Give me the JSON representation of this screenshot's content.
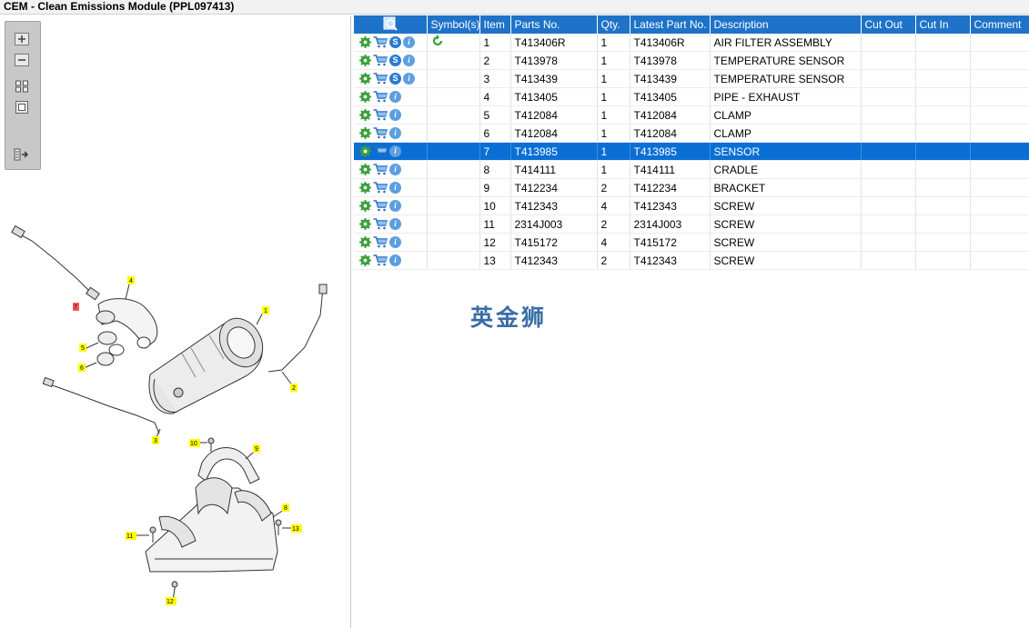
{
  "window": {
    "title": "CEM - Clean Emissions Module (PPL097413)"
  },
  "toolbar": {
    "buttons": [
      {
        "icon": "zoom-in-icon"
      },
      {
        "icon": "zoom-out-icon"
      },
      {
        "icon": "fit-all-icon"
      },
      {
        "icon": "fit-window-icon"
      },
      {
        "icon": "toggle-pane-icon"
      }
    ]
  },
  "diagram": {
    "callouts": [
      "1",
      "2",
      "3",
      "4",
      "5",
      "6",
      "7",
      "8",
      "9",
      "10",
      "11",
      "12",
      "13"
    ]
  },
  "table": {
    "columns": [
      "",
      "Symbol(s)",
      "Item",
      "Parts No.",
      "Qty.",
      "Latest Part No.",
      "Description",
      "Cut Out",
      "Cut In",
      "Comment"
    ],
    "rows": [
      {
        "item": "1",
        "part": "T413406R",
        "qty": "1",
        "latest": "T413406R",
        "desc": "AIR FILTER ASSEMBLY",
        "s": true,
        "symbol": "refresh-arrow"
      },
      {
        "item": "2",
        "part": "T413978",
        "qty": "1",
        "latest": "T413978",
        "desc": "TEMPERATURE SENSOR",
        "s": true
      },
      {
        "item": "3",
        "part": "T413439",
        "qty": "1",
        "latest": "T413439",
        "desc": "TEMPERATURE SENSOR",
        "s": true
      },
      {
        "item": "4",
        "part": "T413405",
        "qty": "1",
        "latest": "T413405",
        "desc": "PIPE - EXHAUST",
        "s": false
      },
      {
        "item": "5",
        "part": "T412084",
        "qty": "1",
        "latest": "T412084",
        "desc": "CLAMP",
        "s": false
      },
      {
        "item": "6",
        "part": "T412084",
        "qty": "1",
        "latest": "T412084",
        "desc": "CLAMP",
        "s": false
      },
      {
        "item": "7",
        "part": "T413985",
        "qty": "1",
        "latest": "T413985",
        "desc": "SENSOR",
        "s": false,
        "selected": true
      },
      {
        "item": "8",
        "part": "T414111",
        "qty": "1",
        "latest": "T414111",
        "desc": "CRADLE",
        "s": false
      },
      {
        "item": "9",
        "part": "T412234",
        "qty": "2",
        "latest": "T412234",
        "desc": "BRACKET",
        "s": false
      },
      {
        "item": "10",
        "part": "T412343",
        "qty": "4",
        "latest": "T412343",
        "desc": "SCREW",
        "s": false
      },
      {
        "item": "11",
        "part": "2314J003",
        "qty": "2",
        "latest": "2314J003",
        "desc": "SCREW",
        "s": false
      },
      {
        "item": "12",
        "part": "T415172",
        "qty": "4",
        "latest": "T415172",
        "desc": "SCREW",
        "s": false
      },
      {
        "item": "13",
        "part": "T412343",
        "qty": "2",
        "latest": "T412343",
        "desc": "SCREW",
        "s": false
      }
    ]
  },
  "watermark": {
    "text": "英金狮"
  },
  "colors": {
    "header": "#1e73c8",
    "selected_row": "#0a6fd4",
    "gear": "#3aa03a",
    "cart": "#2a6fc0",
    "info": "#5d9ee0"
  }
}
